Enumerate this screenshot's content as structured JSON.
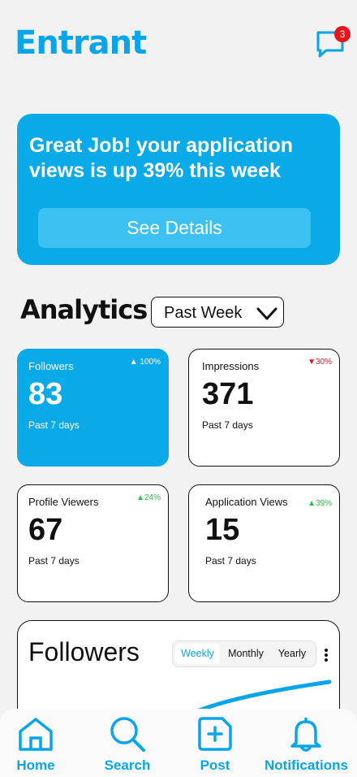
{
  "header": {
    "logo": "Entrant",
    "messages_badge": "3"
  },
  "banner": {
    "message": "Great Job! your application views is up 39% this week",
    "button_label": "See Details"
  },
  "analytics": {
    "title": "Analytics",
    "period": "Past Week"
  },
  "stats": [
    {
      "label": "Followers",
      "value": "83",
      "sub": "Past 7 days",
      "trend": "100%",
      "direction": "up"
    },
    {
      "label": "Impressions",
      "value": "371",
      "sub": "Past 7 days",
      "trend": "30%",
      "direction": "down"
    },
    {
      "label": "Profile Viewers",
      "value": "67",
      "sub": "Past 7 days",
      "trend": "24%",
      "direction": "up"
    },
    {
      "label": "Application Views",
      "value": "15",
      "sub": "Past 7 days",
      "trend": "39%",
      "direction": "up"
    }
  ],
  "followers_chart": {
    "title": "Followers",
    "ranges": [
      "Weekly",
      "Monthly",
      "Yearly"
    ],
    "selected_range": "Weekly"
  },
  "nav": {
    "items": [
      "Home",
      "Search",
      "Post",
      "Notifications"
    ]
  },
  "colors": {
    "accent": "#0aaae9",
    "trend_up": "#2dbb4d",
    "trend_down": "#e8141b",
    "badge": "#e8141b"
  }
}
